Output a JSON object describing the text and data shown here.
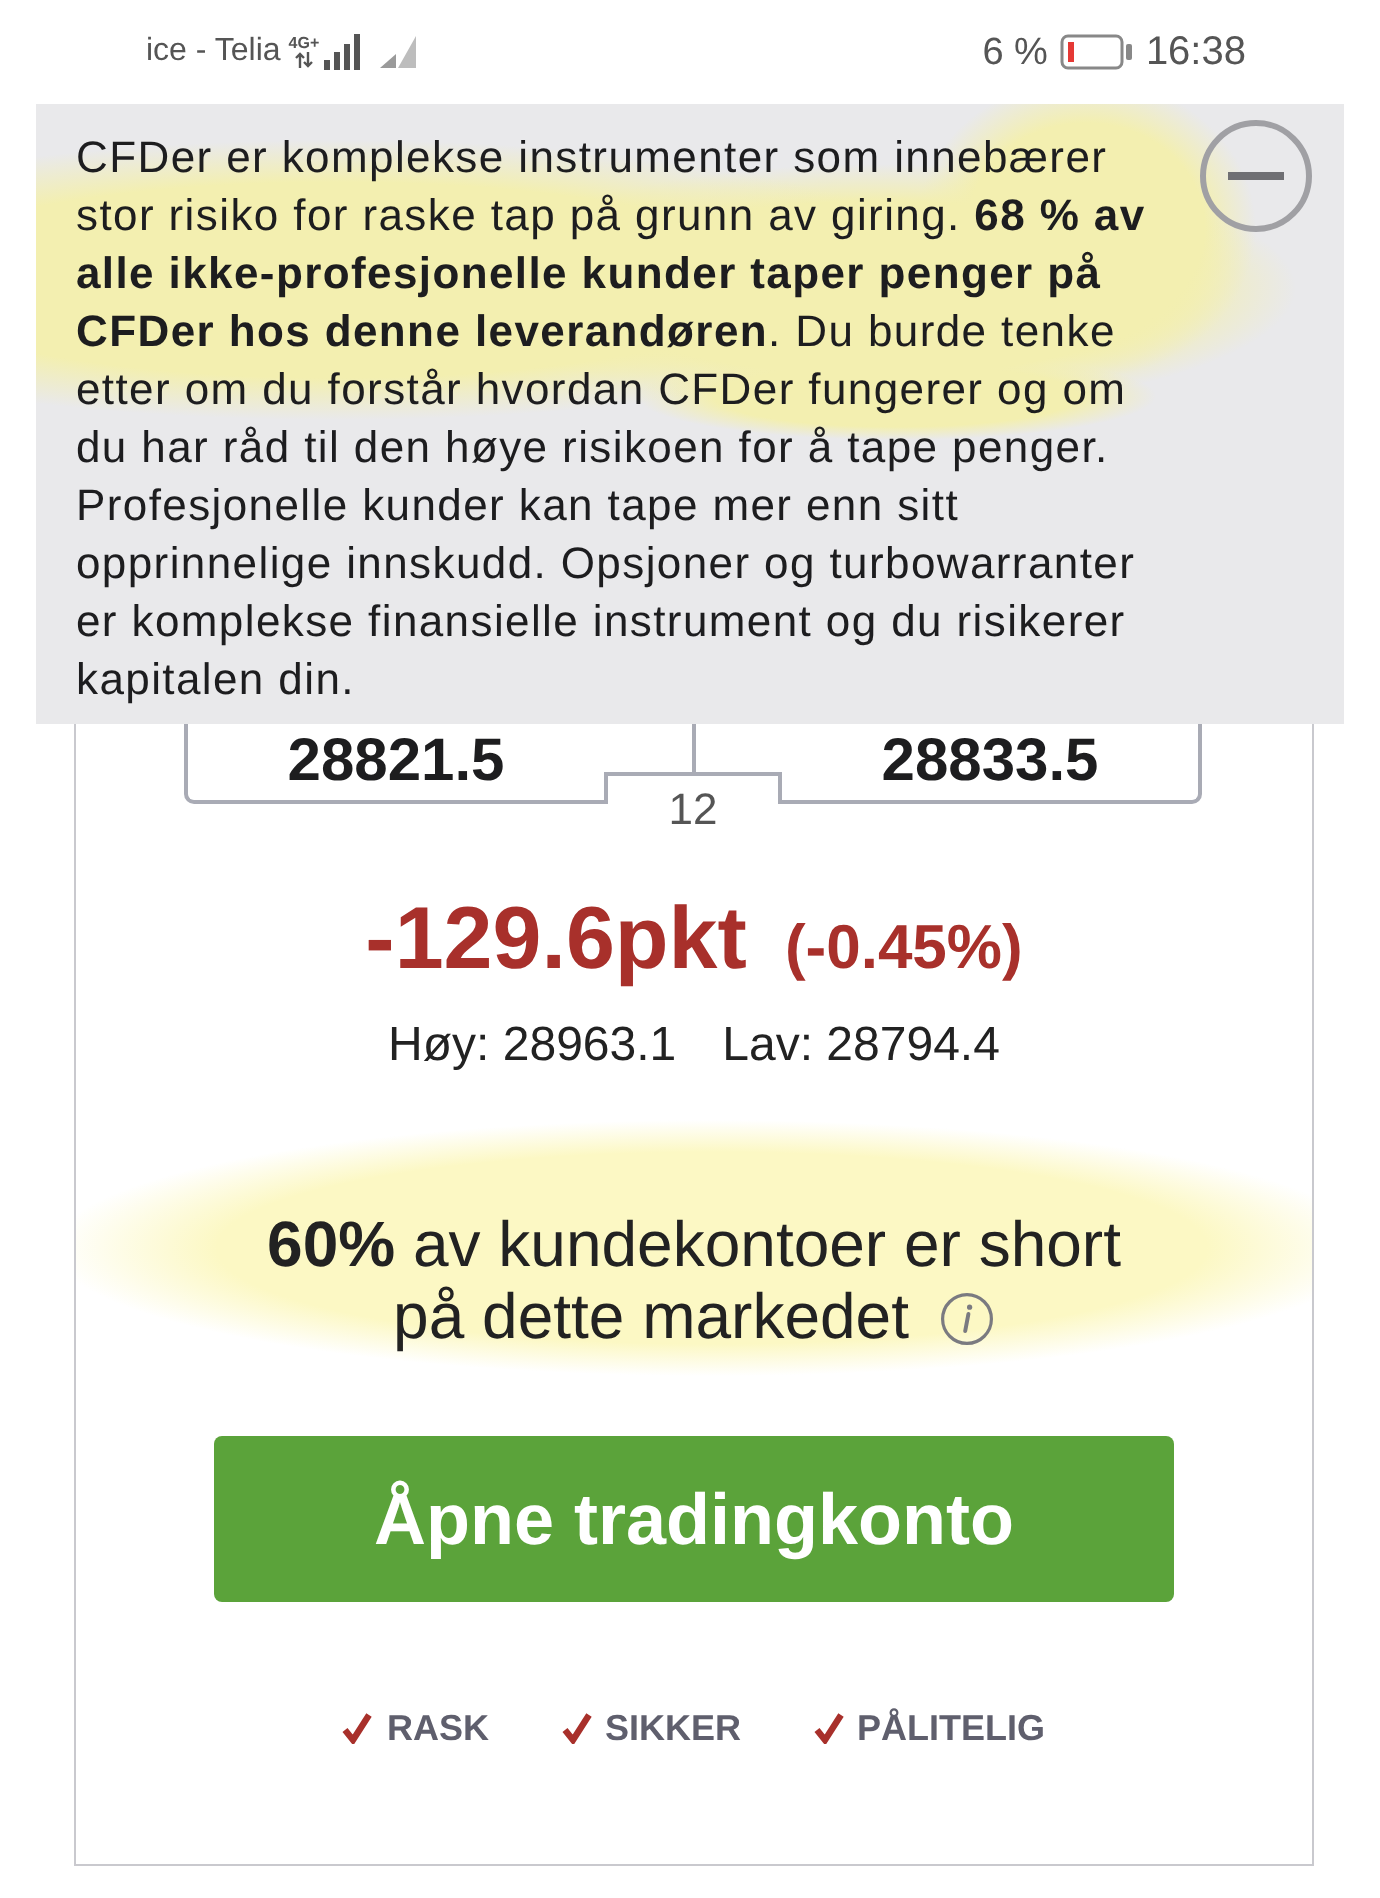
{
  "status_bar": {
    "carrier": "ice - Telia",
    "network_type": "4G+",
    "battery_percent": "6 %",
    "time": "16:38"
  },
  "risk_banner": {
    "text": "CFDer er komplekse instrumenter som innebærer stor risiko for raske tap på grunn av giring. **68 % av alle ikke-profesjonelle kunder taper penger på CFDer hos denne leverandøren**. Du burde tenke etter om du forstår hvordan CFDer fungerer og om du har råd til den høye risikoen for å tape penger. Profesjonelle kunder kan tape mer enn sitt opprinnelige innskudd. Opsjoner og turbowarranter er komplekse finansielle instrument og du risikerer kapitalen din.",
    "expanded": true
  },
  "quote": {
    "sell_price": "28821.5",
    "buy_price": "28833.5",
    "spread": "12",
    "change": "-129.6pkt",
    "change_percent": "(-0.45%)",
    "high": "Høy: 28963.1",
    "low": "Lav: 28794.4"
  },
  "sentiment": {
    "text": "**60%** av kundekontoer er short på dette markedet"
  },
  "cta_button": {
    "label": "Åpne tradingkonto"
  },
  "features": [
    {
      "label": "RASK"
    },
    {
      "label": "SIKKER"
    },
    {
      "label": "PÅLITELIG"
    }
  ]
}
